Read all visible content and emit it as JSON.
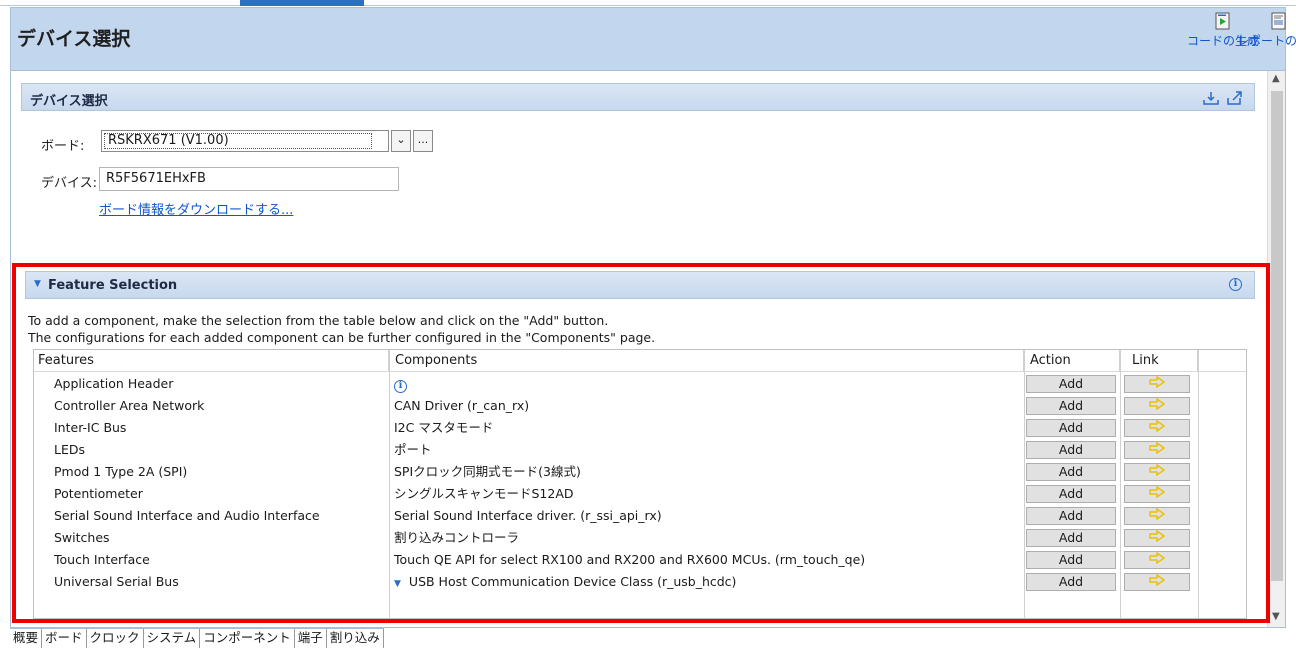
{
  "header": {
    "title": "デバイス選択",
    "buttons": [
      {
        "label": "コードの生成",
        "icon": "code-generate-icon"
      },
      {
        "label": "レポートの生成",
        "icon": "report-generate-icon"
      }
    ]
  },
  "device_section": {
    "title": "デバイス選択",
    "board_label": "ボード:",
    "board_value": "RSKRX671 (V1.00)",
    "browse_label": "...",
    "device_label": "デバイス:",
    "device_value": "R5F5671EHxFB",
    "download_link": "ボード情報をダウンロードする..."
  },
  "feature_section": {
    "title": "Feature Selection",
    "desc_line1": "To add a component, make the selection from the table below and click on the \"Add\" button.",
    "desc_line2": "The configurations for each added component can be further configured in the \"Components\" page.",
    "columns": {
      "features": "Features",
      "components": "Components",
      "action": "Action",
      "link": "Link"
    },
    "rows": [
      {
        "feature": "Application Header",
        "component": "",
        "component_icon": "info-icon",
        "action": "Add"
      },
      {
        "feature": "Controller Area Network",
        "component": "CAN Driver (r_can_rx)",
        "action": "Add"
      },
      {
        "feature": "Inter-IC Bus",
        "component": "I2C マスタモード",
        "action": "Add"
      },
      {
        "feature": "LEDs",
        "component": "ポート",
        "action": "Add"
      },
      {
        "feature": "Pmod 1 Type 2A (SPI)",
        "component": "SPIクロック同期式モード(3線式)",
        "action": "Add"
      },
      {
        "feature": "Potentiometer",
        "component": "シングルスキャンモードS12AD",
        "action": "Add"
      },
      {
        "feature": "Serial Sound Interface and Audio Interface",
        "component": "Serial Sound Interface driver. (r_ssi_api_rx)",
        "action": "Add"
      },
      {
        "feature": "Switches",
        "component": "割り込みコントローラ",
        "action": "Add"
      },
      {
        "feature": "Touch Interface",
        "component": "Touch QE API for select RX100 and RX200 and RX600 MCUs. (rm_touch_qe)",
        "action": "Add"
      },
      {
        "feature": "Universal Serial Bus",
        "component": "USB Host Communication Device Class (r_usb_hcdc)",
        "component_dropdown": true,
        "action": "Add"
      }
    ]
  },
  "bottom_tabs": [
    "概要",
    "ボード",
    "クロック",
    "システム",
    "コンポーネント",
    "端子",
    "割り込み"
  ],
  "colors": {
    "highlight_border": "#ee0000",
    "header_bg": "#c2d6ee",
    "link": "#1155cc",
    "arrow": "#e8c000"
  }
}
